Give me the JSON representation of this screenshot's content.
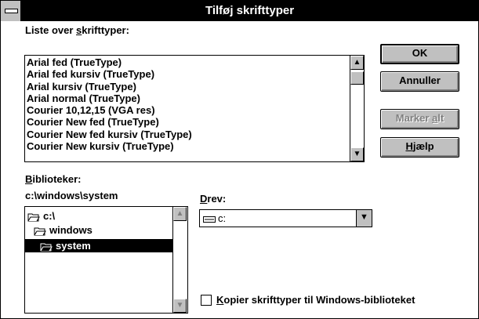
{
  "window": {
    "title": "Tilføj skrifttyper"
  },
  "font_list": {
    "label_pre": "Liste over ",
    "label_key": "s",
    "label_post": "krifttyper:",
    "items": [
      "Arial fed (TrueType)",
      "Arial fed kursiv (TrueType)",
      "Arial kursiv (TrueType)",
      "Arial normal (TrueType)",
      "Courier 10,12,15 (VGA res)",
      "Courier New fed (TrueType)",
      "Courier New fed kursiv (TrueType)",
      "Courier New kursiv (TrueType)"
    ]
  },
  "buttons": {
    "ok": "OK",
    "cancel": "Annuller",
    "select_all_pre": "Marker ",
    "select_all_key": "a",
    "select_all_post": "lt",
    "help_key": "H",
    "help_post": "jælp"
  },
  "directories": {
    "label_key": "B",
    "label_post": "iblioteker:",
    "current_path": "c:\\windows\\system",
    "items": [
      "c:\\",
      "windows",
      "system"
    ],
    "selected": "system"
  },
  "drives": {
    "label_key": "D",
    "label_post": "rev:",
    "value": "c:"
  },
  "copy_option": {
    "key": "K",
    "label_post": "opier skrifttyper til Windows-biblioteket",
    "checked": false
  },
  "icons": [
    "system-menu-icon",
    "scroll-up-arrow-icon",
    "scroll-down-arrow-icon",
    "folder-open-icon",
    "drive-icon",
    "dropdown-arrow-icon"
  ]
}
